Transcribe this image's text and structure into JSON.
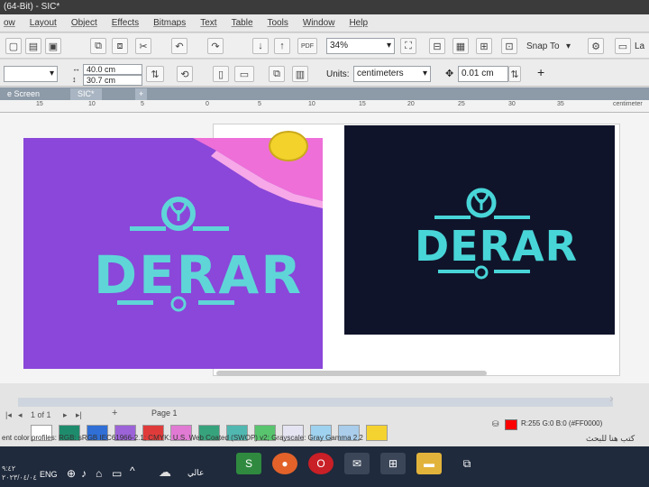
{
  "window": {
    "title": "(64-Bit) - SIC*"
  },
  "menu": [
    {
      "key": "w",
      "label": "ow"
    },
    {
      "key": "layout",
      "label": "Layout"
    },
    {
      "key": "object",
      "label": "Object"
    },
    {
      "key": "effects",
      "label": "Effects"
    },
    {
      "key": "bitmaps",
      "label": "Bitmaps"
    },
    {
      "key": "text",
      "label": "Text"
    },
    {
      "key": "table",
      "label": "Table"
    },
    {
      "key": "tools",
      "label": "Tools"
    },
    {
      "key": "window",
      "label": "Window"
    },
    {
      "key": "help",
      "label": "Help"
    }
  ],
  "toolbar": {
    "pdf_label": "PDF",
    "zoom": "34%",
    "snap_label": "Snap To",
    "launch_label": "La"
  },
  "property_bar": {
    "width": "40.0 cm",
    "height": "30.7 cm",
    "units_label": "Units:",
    "units_value": "centimeters",
    "nudge": "0.01 cm"
  },
  "tabs": [
    {
      "label": "e Screen"
    },
    {
      "label": "SIC*"
    }
  ],
  "ruler": {
    "ticks": [
      "15",
      "10",
      "5",
      "0",
      "5",
      "10",
      "15",
      "20",
      "25",
      "30",
      "35"
    ],
    "unit": "centimeter"
  },
  "artwork": {
    "left": {
      "logo_text": "DERAR",
      "bg": "#8a47d9",
      "accent": "#5fd5d8"
    },
    "right": {
      "logo_text": "DERAR",
      "bg": "#10142a",
      "accent": "#48d5d8"
    }
  },
  "page_nav": {
    "page_of": "1 of 1",
    "page_tab": "Page 1"
  },
  "palette": {
    "swatches": [
      "#ffffff",
      "#1e8c6c",
      "#2f6fd6",
      "#9c63d8",
      "#e03b3b",
      "#e07ad3",
      "#37a37c",
      "#50b8b0",
      "#58c46e",
      "#e4e4f2",
      "#9fd2ef",
      "#a9cdea",
      "#f4d330"
    ]
  },
  "status": {
    "color_profiles": "ent color profiles: RGB: sRGB IEC61966-2.1; CMYK: U.S. Web Coated (SWOP) v2; Grayscale: Gray Gamma 2.2",
    "fill_readout": "R:255 G:0 B:0 (#FF0000)",
    "arabic_text": "كتب هنا للبحث",
    "fill_color": "#ff0000"
  },
  "taskbar": {
    "lang": "ENG",
    "weather_text": "عالي",
    "clock_time": "٩:٤٢",
    "clock_date": "٢٠٢٣/٠٤/٠٤"
  }
}
